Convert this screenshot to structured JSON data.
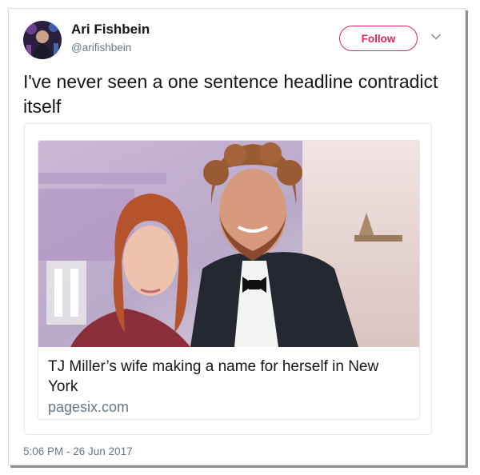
{
  "tweet": {
    "author_name": "Ari Fishbein",
    "author_handle": "@arifishbein",
    "follow_label": "Follow",
    "text": "I've never seen a one sentence headline contradict itself",
    "timestamp": "5:06 PM - 26 Jun 2017"
  },
  "link_card": {
    "title": "TJ Miller’s wife making a name for herself in New York",
    "domain": "pagesix.com"
  },
  "colors": {
    "follow_accent": "#e0245e",
    "secondary_text": "#657786"
  },
  "icons": {
    "menu": "chevron-down-icon"
  }
}
